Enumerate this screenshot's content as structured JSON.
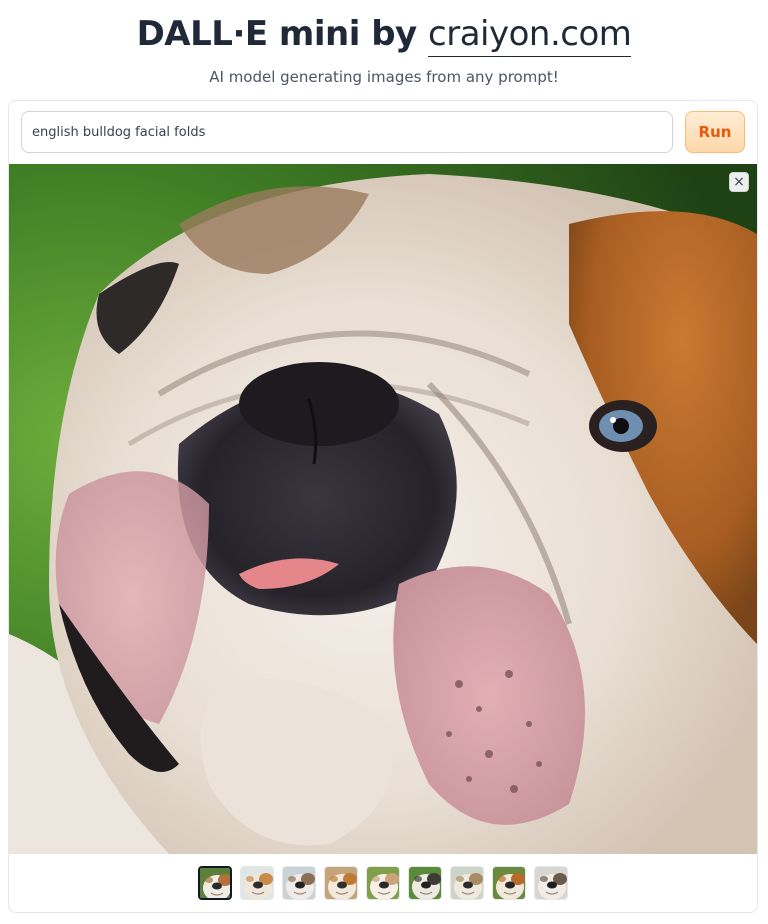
{
  "header": {
    "title_prefix": "DALL·E mini by ",
    "title_link": "craiyon.com",
    "subtitle": "AI model generating images from any prompt!"
  },
  "prompt": {
    "value": "english bulldog facial folds",
    "run_label": "Run"
  },
  "result": {
    "close_icon": "×",
    "selected_thumbnail": 1,
    "thumbnails": [
      {
        "bg": "#5c7f3a",
        "fur": "#f1ece4",
        "patch": "#b0723a",
        "nose": "#2a2a2a"
      },
      {
        "bg": "#dfe6e4",
        "fur": "#efe7dc",
        "patch": "#c98c4c",
        "nose": "#2d2d2d"
      },
      {
        "bg": "#c9d3d6",
        "fur": "#f0ebe6",
        "patch": "#8a6f55",
        "nose": "#222222"
      },
      {
        "bg": "#c6a47a",
        "fur": "#f3e9da",
        "patch": "#c07a36",
        "nose": "#303030"
      },
      {
        "bg": "#7fa04a",
        "fur": "#f5efe6",
        "patch": "#caa37a",
        "nose": "#2a2a2a"
      },
      {
        "bg": "#5b8a3a",
        "fur": "#eeeae2",
        "patch": "#3e3a36",
        "nose": "#202020"
      },
      {
        "bg": "#cfd4c9",
        "fur": "#f0e9de",
        "patch": "#a98c64",
        "nose": "#2b2b2b"
      },
      {
        "bg": "#6a8a3e",
        "fur": "#f2e8da",
        "patch": "#b86a2a",
        "nose": "#252525"
      },
      {
        "bg": "#d9d6d2",
        "fur": "#f1ece6",
        "patch": "#6a5a4e",
        "nose": "#1e1e1e"
      }
    ]
  }
}
